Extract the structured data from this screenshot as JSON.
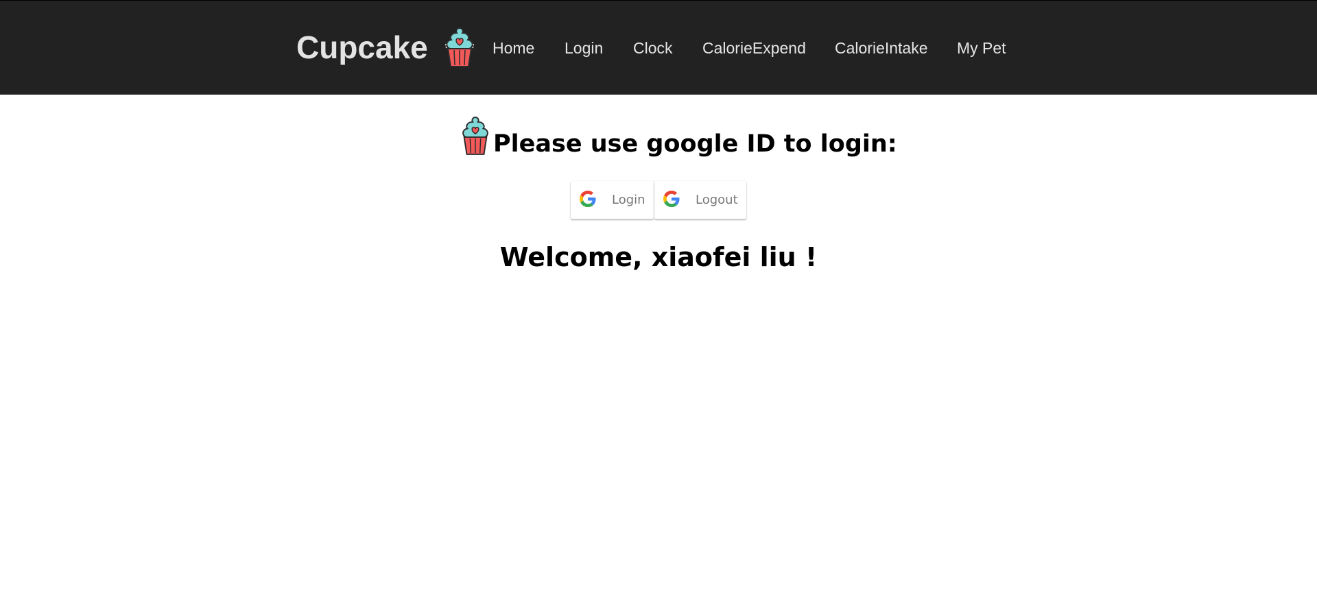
{
  "nav": {
    "brand": "Cupcake",
    "brand_logo_icon": "cupcake-icon",
    "links": [
      {
        "label": "Home"
      },
      {
        "label": "Login"
      },
      {
        "label": "Clock"
      },
      {
        "label": "CalorieExpend"
      },
      {
        "label": "CalorieIntake"
      },
      {
        "label": "My Pet"
      }
    ]
  },
  "main": {
    "heading_icon": "cupcake-icon",
    "heading": "Please use google ID to login:",
    "buttons": {
      "login_label": "Login",
      "logout_label": "Logout",
      "icon": "google-icon"
    },
    "welcome_prefix": "Welcome, ",
    "user_name": "xiaofei liu",
    "welcome_suffix": " !"
  },
  "colors": {
    "navbar_bg": "#222222",
    "nav_text": "#e6e6e6",
    "cupcake_frosting": "#7fd8d8",
    "cupcake_wrapper": "#f25a5a",
    "cupcake_outline": "#2b2b2b"
  }
}
